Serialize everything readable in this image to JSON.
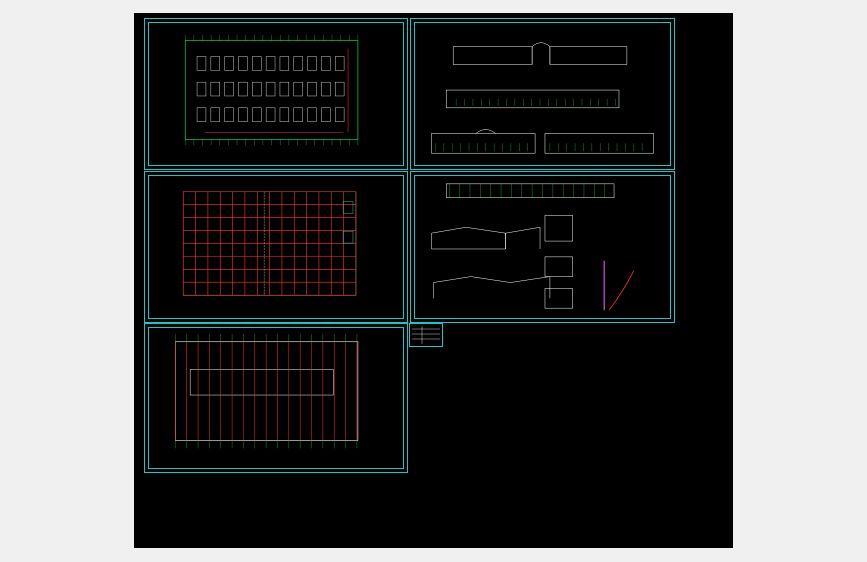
{
  "viewer": {
    "background_color": "#000000",
    "frame_color": "#18c7c7",
    "line_colors": [
      "#ffffff",
      "#ff3333",
      "#00ff66",
      "#ffff33",
      "#18c7c7",
      "#ff66ff"
    ]
  },
  "sheets": [
    {
      "id": "floor-plan-1",
      "kind": "floor-plan-grid",
      "caption": ""
    },
    {
      "id": "elevations",
      "kind": "elevations",
      "caption": ""
    },
    {
      "id": "floor-plan-2",
      "kind": "floor-plan-red-grid",
      "caption": ""
    },
    {
      "id": "sections-details",
      "kind": "sections",
      "caption": ""
    },
    {
      "id": "roof-plan",
      "kind": "roof-plan",
      "caption": ""
    }
  ],
  "legend": {
    "caption": ""
  },
  "side_labels": [
    "",
    "",
    ""
  ]
}
